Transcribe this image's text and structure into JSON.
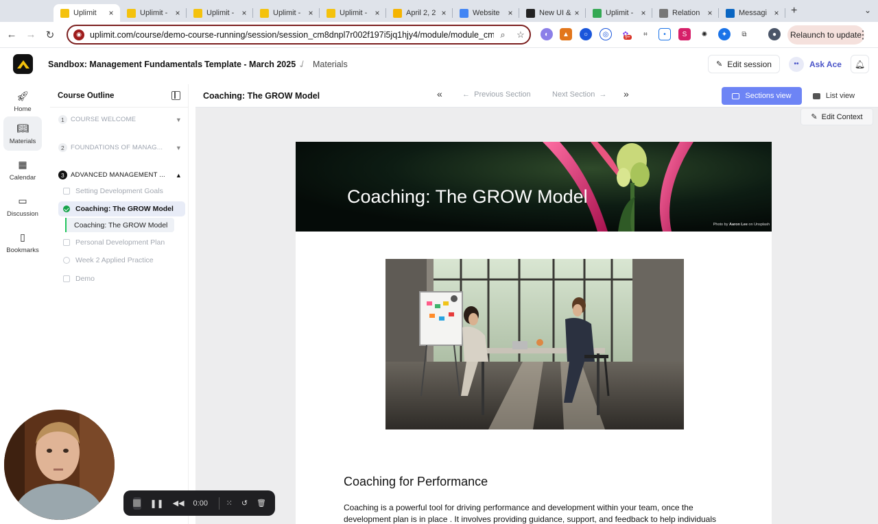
{
  "browser": {
    "tabs": [
      {
        "title": "Uplimit",
        "color": "#f4c20d",
        "active": true
      },
      {
        "title": "Uplimit -",
        "color": "#f4c20d"
      },
      {
        "title": "Uplimit -",
        "color": "#f4c20d"
      },
      {
        "title": "Uplimit -",
        "color": "#f4c20d"
      },
      {
        "title": "Uplimit -",
        "color": "#f4c20d"
      },
      {
        "title": "April 2, 2",
        "color": "#f5b400"
      },
      {
        "title": "Website",
        "color": "#4285f4"
      },
      {
        "title": "New UI &",
        "color": "#222222"
      },
      {
        "title": "Uplimit -",
        "color": "#34a853"
      },
      {
        "title": "Relation",
        "color": "#777777"
      },
      {
        "title": "Messagi",
        "color": "#0a66c2"
      }
    ],
    "new_tab": "+",
    "url": "uplimit.com/course/demo-course-running/session/session_cm8dnpl7r002f197i5jq1hjy4/module/module_cm...",
    "relaunch_label": "Relaunch to update",
    "ext_badge": "9+"
  },
  "app": {
    "accent": "#6d84f5",
    "breadcrumb": {
      "program": "Sandbox: Management Fundamentals",
      "template": "Template - March 2025",
      "page": "Materials"
    },
    "edit_session_label": "Edit session",
    "ask_ace_label": "Ask Ace"
  },
  "leftnav": {
    "items": [
      {
        "label": "Home",
        "icon": "rocket-icon"
      },
      {
        "label": "Materials",
        "icon": "book-icon",
        "active": true
      },
      {
        "label": "Calendar",
        "icon": "calendar-icon"
      },
      {
        "label": "Discussion",
        "icon": "chat-icon"
      },
      {
        "label": "Bookmarks",
        "icon": "bookmark-icon"
      }
    ]
  },
  "outline": {
    "title": "Course Outline",
    "modules": [
      {
        "num": "1",
        "label": "COURSE WELCOME"
      },
      {
        "num": "2",
        "label": "FOUNDATIONS OF MANAG..."
      },
      {
        "num": "3",
        "label": "ADVANCED MANAGEMENT ..."
      }
    ],
    "sessions": [
      {
        "label": "Setting Development Goals"
      },
      {
        "label": "Coaching: The GROW Model",
        "active": true
      },
      {
        "label": "Personal Development Plan"
      },
      {
        "label": "Week 2 Applied Practice"
      },
      {
        "label": "Demo"
      }
    ],
    "active_section": "Coaching: The GROW Model"
  },
  "main": {
    "title": "Coaching: The GROW Model",
    "prev_label": "Previous Section",
    "next_label": "Next Section",
    "sections_view_label": "Sections view",
    "list_view_label": "List view",
    "edit_context_label": "Edit Context",
    "hero_title": "Coaching: The GROW Model",
    "hero_credit_prefix": "Photo by",
    "hero_credit_author": "Aaron Lee",
    "hero_credit_suffix": "on Unsplash",
    "section_heading": "Coaching for Performance",
    "paragraph": "Coaching is a powerful tool for driving performance and development within your team, once the development plan is in place . It involves providing guidance, support, and feedback to help individuals"
  },
  "recorder": {
    "time": "0:00"
  }
}
